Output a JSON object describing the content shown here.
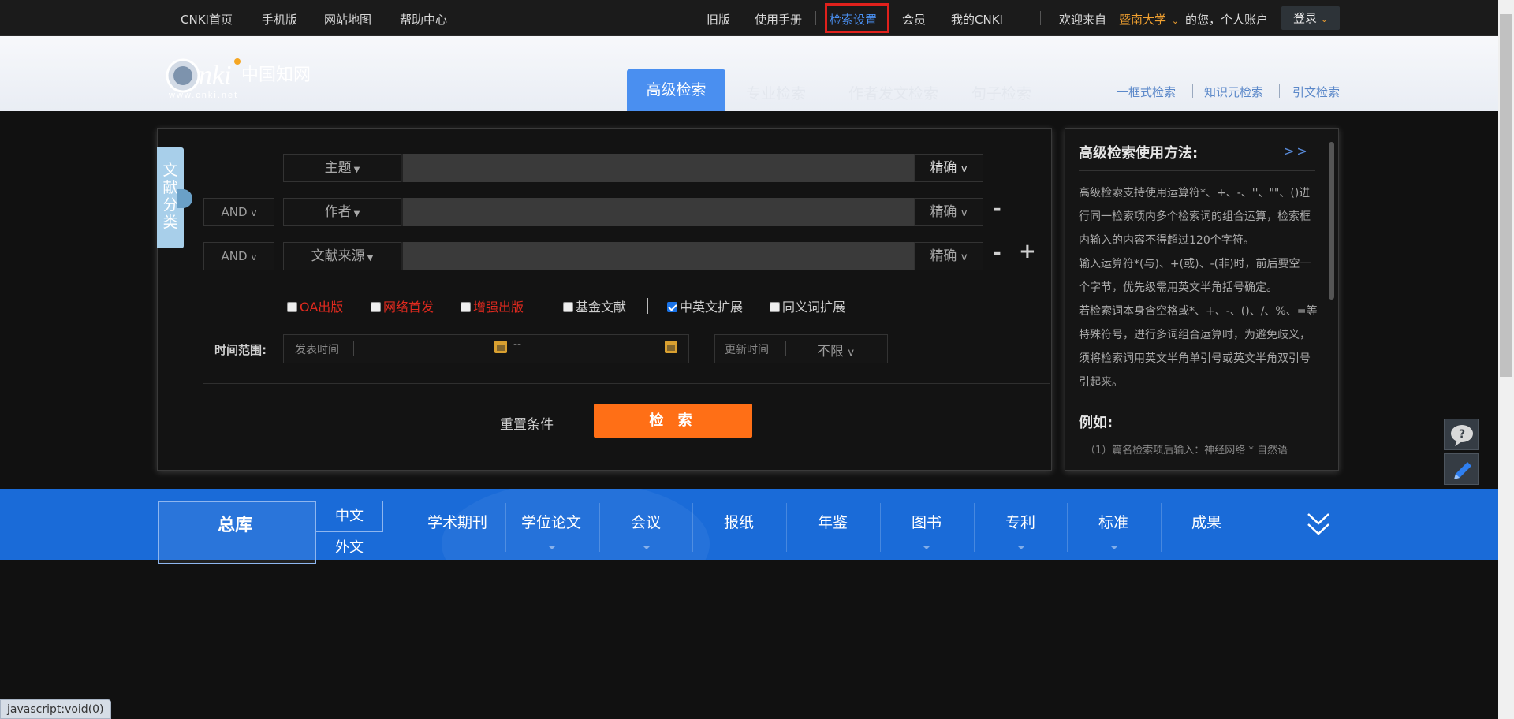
{
  "topbar": {
    "left_links": [
      "CNKI首页",
      "手机版",
      "网站地图",
      "帮助中心"
    ],
    "right_links": [
      "旧版",
      "使用手册",
      "检索设置",
      "会员",
      "我的CNKI"
    ],
    "welcome": "欢迎来自",
    "institution": "暨南大学",
    "account_text": "的您，个人账户",
    "login_label": "登录"
  },
  "header": {
    "logo_text": "cnki中国知网",
    "logo_url_text": "www.cnki.net",
    "tabs": [
      "高级检索",
      "专业检索",
      "作者发文检索",
      "句子检索"
    ],
    "right_links": [
      "一框式检索",
      "知识元检索",
      "引文检索"
    ]
  },
  "side_tab": {
    "chars": [
      "文",
      "献",
      "分",
      "类"
    ]
  },
  "search": {
    "rows": [
      {
        "op": "",
        "field": "主题",
        "match": "精确"
      },
      {
        "op": "AND",
        "field": "作者",
        "match": "精确"
      },
      {
        "op": "AND",
        "field": "文献来源",
        "match": "精确"
      }
    ],
    "checkboxes": [
      {
        "label": "OA出版",
        "checked": false,
        "color": "#e02a1f"
      },
      {
        "label": "网络首发",
        "checked": false,
        "color": "#e02a1f"
      },
      {
        "label": "增强出版",
        "checked": false,
        "color": "#e02a1f"
      },
      {
        "label": "基金文献",
        "checked": false,
        "color": "#cfcfcf"
      },
      {
        "label": "中英文扩展",
        "checked": true,
        "color": "#cfcfcf"
      },
      {
        "label": "同义词扩展",
        "checked": false,
        "color": "#cfcfcf"
      }
    ],
    "time_label": "时间范围:",
    "pub_time_label": "发表时间",
    "range_sep": "--",
    "update_time_label": "更新时间",
    "update_time_value": "不限",
    "reset_label": "重置条件",
    "search_label": "检 索"
  },
  "help": {
    "title": "高级检索使用方法:",
    "more": ">>",
    "paragraphs": [
      "高级检索支持使用运算符*、+、-、''、\"\"、()进行同一检索项内多个检索词的组合运算，检索框内输入的内容不得超过120个字符。",
      "输入运算符*(与)、+(或)、-(非)时，前后要空一个字节，优先级需用英文半角括号确定。",
      "若检索词本身含空格或*、+、-、()、/、%、=等特殊符号，进行多词组合运算时，为避免歧义，须将检索词用英文半角单引号或英文半角双引号引起来。"
    ],
    "example_title": "例如:",
    "example_1": "（1）篇名检索项后输入：神经网络 * 自然语"
  },
  "categories": {
    "total": "总库",
    "zh": "中文",
    "en": "外文",
    "items": [
      "学术期刊",
      "学位论文",
      "会议",
      "报纸",
      "年鉴",
      "图书",
      "专利",
      "标准",
      "成果"
    ]
  },
  "status_bar": "javascript:void(0)",
  "colors": {
    "accent_blue": "#4a8ff0",
    "search_orange": "#ff6f16",
    "category_bar": "#1a6bd8",
    "highlight_red": "#e0211c",
    "institution_orange": "#f0a030"
  }
}
